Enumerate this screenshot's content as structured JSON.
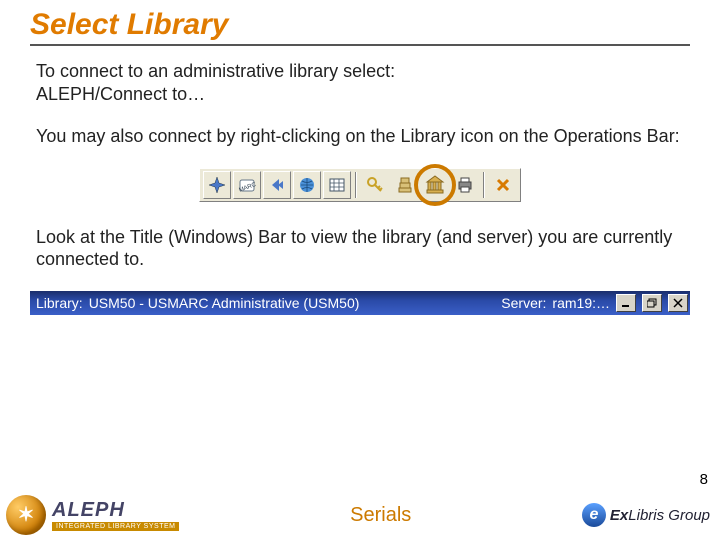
{
  "title": "Select Library",
  "paragraphs": {
    "p1a": "To connect to an administrative library select:",
    "p1b": "ALEPH/Connect to…",
    "p2": "You may also connect by right-clicking on the Library icon on the Operations Bar:",
    "p3": "Look at the Title (Windows) Bar to view the library (and server) you are currently connected to."
  },
  "toolbar": {
    "icons": {
      "nav": "nav-icon",
      "marc": "marc-icon",
      "prev": "prev-icon",
      "globe": "globe-icon",
      "grid": "grid-icon",
      "key": "key-icon",
      "server": "server-icon",
      "library": "library-icon",
      "print": "print-icon",
      "close": "close-icon"
    }
  },
  "titlebar": {
    "library_label": "Library:",
    "library_value": "USM50 - USMARC Administrative (USM50)",
    "server_label": "Server:",
    "server_value": "ram19:…"
  },
  "page_number": "8",
  "footer": {
    "aleph_name": "ALEPH",
    "aleph_sub": "INTEGRATED LIBRARY SYSTEM",
    "center": "Serials",
    "exlibris_prefix": "Ex",
    "exlibris_mid": "Libris",
    "exlibris_suffix": " Group"
  }
}
